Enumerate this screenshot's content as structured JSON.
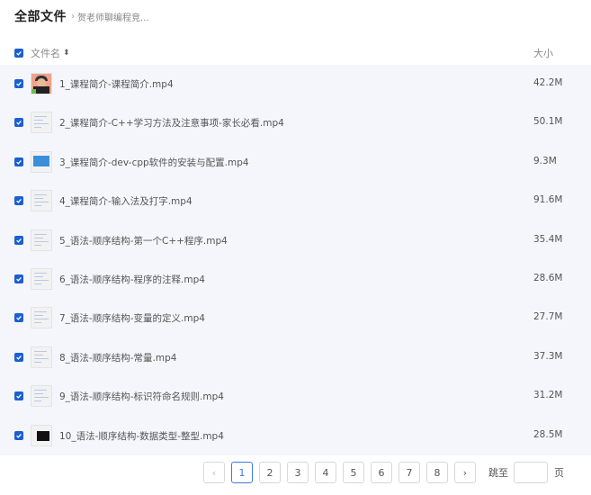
{
  "header": {
    "title": "全部文件",
    "separator": "›",
    "breadcrumb": "贺老师聊编程竞..."
  },
  "table": {
    "col_name": "文件名",
    "sort_icon": "⬍",
    "col_size": "大小"
  },
  "files": [
    {
      "name": "1_课程简介-课程简介.mp4",
      "size": "42.2M",
      "thumb": "face"
    },
    {
      "name": "2_课程简介-C++学习方法及注意事项-家长必看.mp4",
      "size": "50.1M",
      "thumb": "doc"
    },
    {
      "name": "3_课程简介-dev-cpp软件的安装与配置.mp4",
      "size": "9.3M",
      "thumb": "blue"
    },
    {
      "name": "4_课程简介-输入法及打字.mp4",
      "size": "91.6M",
      "thumb": "doc"
    },
    {
      "name": "5_语法-顺序结构-第一个C++程序.mp4",
      "size": "35.4M",
      "thumb": "doc"
    },
    {
      "name": "6_语法-顺序结构-程序的注释.mp4",
      "size": "28.6M",
      "thumb": "doc"
    },
    {
      "name": "7_语法-顺序结构-变量的定义.mp4",
      "size": "27.7M",
      "thumb": "doc"
    },
    {
      "name": "8_语法-顺序结构-常量.mp4",
      "size": "37.3M",
      "thumb": "doc"
    },
    {
      "name": "9_语法-顺序结构-标识符命名规则.mp4",
      "size": "31.2M",
      "thumb": "doc"
    },
    {
      "name": "10_语法-顺序结构-数据类型-整型.mp4",
      "size": "28.5M",
      "thumb": "dark"
    }
  ],
  "pagination": {
    "prev": "‹",
    "pages": [
      "1",
      "2",
      "3",
      "4",
      "5",
      "6",
      "7",
      "8"
    ],
    "current": "1",
    "next": "›",
    "jump_label": "跳至",
    "jump_value": "",
    "page_word": "页"
  },
  "colors": {
    "checkbox": "#1b5fd0",
    "row_background": "#f4f6fc",
    "active_page": "#3d7be0"
  }
}
